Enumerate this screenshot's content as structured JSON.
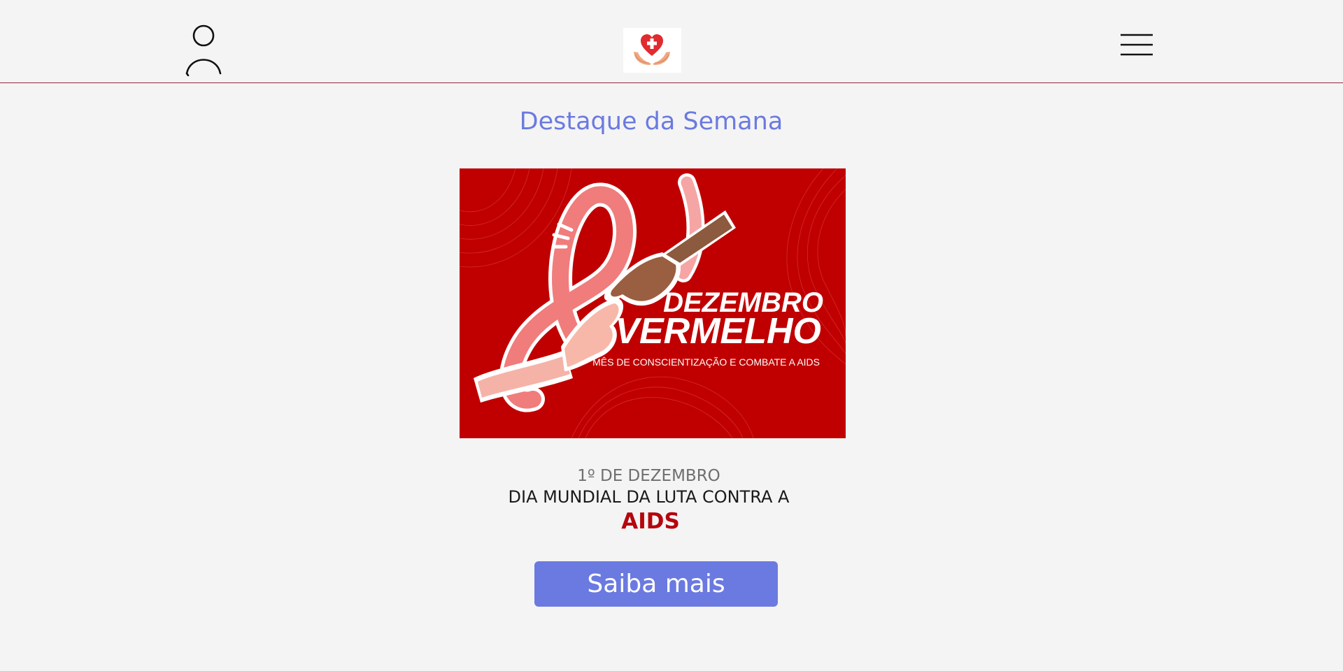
{
  "header": {
    "user_icon": "user-icon",
    "logo_icon": "heart-cross-hands-logo",
    "menu_icon": "hamburger-menu-icon",
    "border_color": "#8e2a3c"
  },
  "main": {
    "title": "Destaque da Semana",
    "banner": {
      "headline_1": "DEZEMBRO",
      "headline_2": "VERMELHO",
      "tagline": "MÊS DE CONSCIENTIZAÇÃO E COMBATE A AIDS",
      "background_color": "#c00000"
    },
    "date_text": "1º DE DEZEMBRO",
    "subtitle": "DIA MUNDIAL DA LUTA CONTRA A",
    "highlight": "AIDS",
    "cta_label": "Saiba mais"
  },
  "colors": {
    "accent": "#6b7ae0",
    "highlight": "#b5060e",
    "page_background": "#f4f4f4"
  }
}
